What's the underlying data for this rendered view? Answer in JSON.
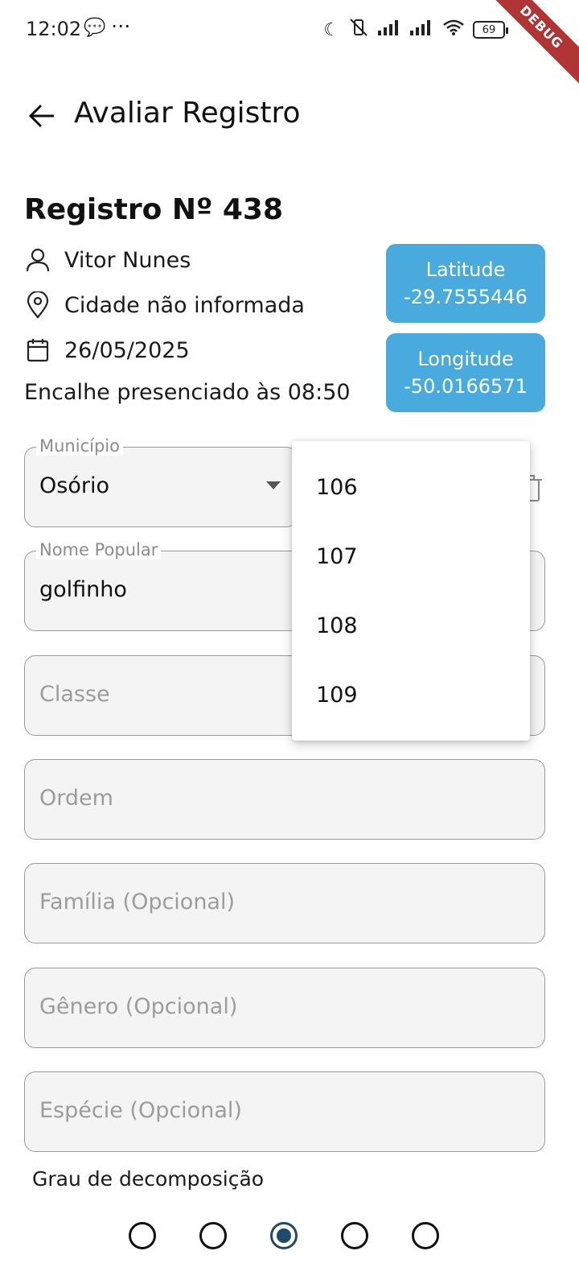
{
  "status_bar": {
    "time": "12:02",
    "battery": "69",
    "debug_label": "DEBUG"
  },
  "app_bar": {
    "title": "Avaliar Registro"
  },
  "record": {
    "title": "Registro Nº 438",
    "user": "Vitor Nunes",
    "city": "Cidade não informada",
    "date": "26/05/2025",
    "sighting": "Encalhe presenciado às 08:50",
    "latitude": {
      "label": "Latitude",
      "value": "-29.7555446"
    },
    "longitude": {
      "label": "Longitude",
      "value": "-50.0166571"
    }
  },
  "form": {
    "municipio": {
      "label": "Município",
      "value": "Osório"
    },
    "nome_popular": {
      "label": "Nome Popular",
      "value": "golfinho"
    },
    "classe": {
      "placeholder": "Classe"
    },
    "ordem": {
      "placeholder": "Ordem"
    },
    "familia": {
      "placeholder": "Família (Opcional)"
    },
    "genero": {
      "placeholder": "Gênero (Opcional)"
    },
    "especie": {
      "placeholder": "Espécie (Opcional)"
    }
  },
  "dropdown_menu": {
    "items": [
      "106",
      "107",
      "108",
      "109"
    ]
  },
  "decomposition": {
    "label": "Grau de decomposição",
    "options_count": 5,
    "selected_index": 2
  },
  "colors": {
    "accent": "#49aadd",
    "radio_selected": "#1e4a6c",
    "debug_ribbon": "#b03434"
  }
}
